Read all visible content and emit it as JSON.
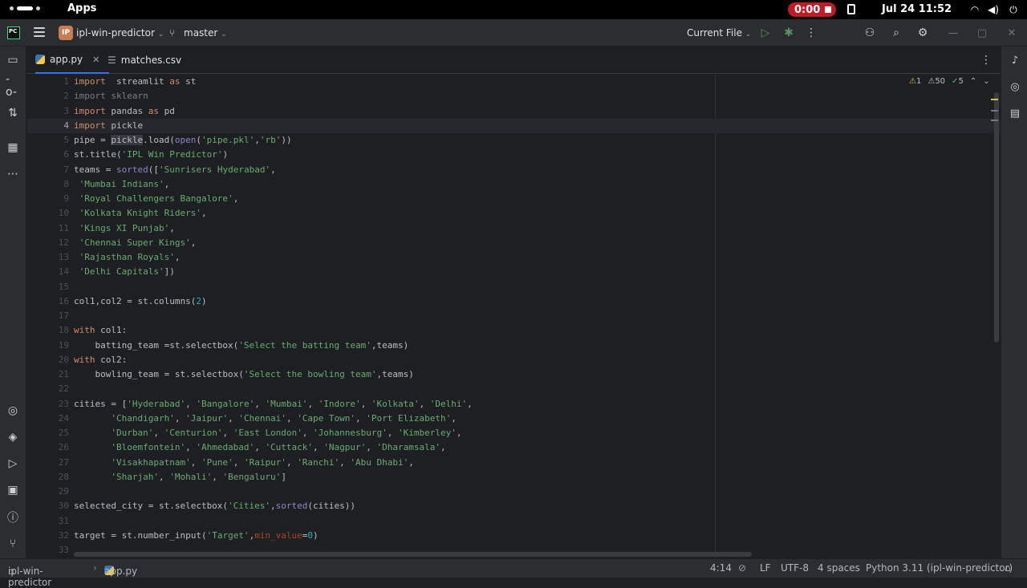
{
  "os": {
    "apps_label": "Apps",
    "recording_time": "0:00",
    "clock": "Jul 24  11:52"
  },
  "toolbar": {
    "app_logo": "PC",
    "project_badge": "IP",
    "project_name": "ipl-win-predictor",
    "branch_name": "master",
    "run_config": "Current File"
  },
  "tabs": [
    {
      "label": "app.py",
      "active": true
    },
    {
      "label": "matches.csv",
      "active": false
    }
  ],
  "inspections": {
    "warnings": "1",
    "weak_warnings": "50",
    "typos": "5"
  },
  "editor": {
    "current_line": 4,
    "lines": [
      {
        "n": "1",
        "t": [
          [
            "kw",
            "import"
          ],
          [
            "",
            "  streamlit "
          ],
          [
            "kw",
            "as"
          ],
          [
            "",
            " st"
          ]
        ]
      },
      {
        "n": "2",
        "t": [
          [
            "dim",
            "import sklearn"
          ]
        ]
      },
      {
        "n": "3",
        "t": [
          [
            "kw",
            "import"
          ],
          [
            "",
            " pandas "
          ],
          [
            "kw",
            "as"
          ],
          [
            "",
            " pd"
          ]
        ]
      },
      {
        "n": "4",
        "t": [
          [
            "kw",
            "import"
          ],
          [
            "",
            " pickle"
          ]
        ]
      },
      {
        "n": "5",
        "t": [
          [
            "",
            "pipe = "
          ],
          [
            "hl",
            "pickle"
          ],
          [
            "",
            ".load("
          ],
          [
            "bi",
            "open"
          ],
          [
            "",
            "("
          ],
          [
            "str",
            "'pipe.pkl'"
          ],
          [
            "",
            ","
          ],
          [
            "str",
            "'rb'"
          ],
          [
            "",
            "))"
          ]
        ]
      },
      {
        "n": "6",
        "t": [
          [
            "",
            "st.title("
          ],
          [
            "str",
            "'IPL Win Predictor'"
          ],
          [
            "",
            ")"
          ]
        ]
      },
      {
        "n": "7",
        "t": [
          [
            "",
            "teams = "
          ],
          [
            "bi",
            "sorted"
          ],
          [
            "",
            "(["
          ],
          [
            "str",
            "'Sunrisers Hyderabad'"
          ],
          [
            "",
            ","
          ]
        ]
      },
      {
        "n": "8",
        "t": [
          [
            "",
            " "
          ],
          [
            "str",
            "'Mumbai Indians'"
          ],
          [
            "",
            ","
          ]
        ]
      },
      {
        "n": "9",
        "t": [
          [
            "",
            " "
          ],
          [
            "str",
            "'Royal Challengers Bangalore'"
          ],
          [
            "",
            ","
          ]
        ]
      },
      {
        "n": "10",
        "t": [
          [
            "",
            " "
          ],
          [
            "str",
            "'Kolkata Knight Riders'"
          ],
          [
            "",
            ","
          ]
        ]
      },
      {
        "n": "11",
        "t": [
          [
            "",
            " "
          ],
          [
            "str",
            "'Kings XI Punjab'"
          ],
          [
            "",
            ","
          ]
        ]
      },
      {
        "n": "12",
        "t": [
          [
            "",
            " "
          ],
          [
            "str",
            "'Chennai Super Kings'"
          ],
          [
            "",
            ","
          ]
        ]
      },
      {
        "n": "13",
        "t": [
          [
            "",
            " "
          ],
          [
            "str",
            "'Rajasthan Royals'"
          ],
          [
            "",
            ","
          ]
        ]
      },
      {
        "n": "14",
        "t": [
          [
            "",
            " "
          ],
          [
            "str",
            "'Delhi Capitals'"
          ],
          [
            "",
            "])"
          ]
        ]
      },
      {
        "n": "15",
        "t": []
      },
      {
        "n": "16",
        "t": [
          [
            "",
            "col1,col2 = st.columns("
          ],
          [
            "num",
            "2"
          ],
          [
            "",
            ")"
          ]
        ]
      },
      {
        "n": "17",
        "t": []
      },
      {
        "n": "18",
        "t": [
          [
            "kw",
            "with"
          ],
          [
            "",
            " col1:"
          ]
        ]
      },
      {
        "n": "19",
        "t": [
          [
            "",
            "    batting_team =st.selectbox("
          ],
          [
            "str",
            "'Select the batting team'"
          ],
          [
            "",
            ",teams)"
          ]
        ]
      },
      {
        "n": "20",
        "t": [
          [
            "kw",
            "with"
          ],
          [
            "",
            " col2:"
          ]
        ]
      },
      {
        "n": "21",
        "t": [
          [
            "",
            "    bowling_team = st.selectbox("
          ],
          [
            "str",
            "'Select the bowling team'"
          ],
          [
            "",
            ",teams)"
          ]
        ]
      },
      {
        "n": "22",
        "t": []
      },
      {
        "n": "23",
        "t": [
          [
            "",
            "cities = ["
          ],
          [
            "str",
            "'Hyderabad'"
          ],
          [
            "",
            ", "
          ],
          [
            "str",
            "'Bangalore'"
          ],
          [
            "",
            ", "
          ],
          [
            "str",
            "'Mumbai'"
          ],
          [
            "",
            ", "
          ],
          [
            "str",
            "'Indore'"
          ],
          [
            "",
            ", "
          ],
          [
            "str",
            "'Kolkata'"
          ],
          [
            "",
            ", "
          ],
          [
            "str",
            "'Delhi'"
          ],
          [
            "",
            ","
          ]
        ]
      },
      {
        "n": "24",
        "t": [
          [
            "",
            "       "
          ],
          [
            "str",
            "'Chandigarh'"
          ],
          [
            "",
            ", "
          ],
          [
            "str",
            "'Jaipur'"
          ],
          [
            "",
            ", "
          ],
          [
            "str",
            "'Chennai'"
          ],
          [
            "",
            ", "
          ],
          [
            "str",
            "'Cape Town'"
          ],
          [
            "",
            ", "
          ],
          [
            "str",
            "'Port Elizabeth'"
          ],
          [
            "",
            ","
          ]
        ]
      },
      {
        "n": "25",
        "t": [
          [
            "",
            "       "
          ],
          [
            "str",
            "'Durban'"
          ],
          [
            "",
            ", "
          ],
          [
            "str",
            "'Centurion'"
          ],
          [
            "",
            ", "
          ],
          [
            "str",
            "'East London'"
          ],
          [
            "",
            ", "
          ],
          [
            "str",
            "'Johannesburg'"
          ],
          [
            "",
            ", "
          ],
          [
            "str",
            "'Kimberley'"
          ],
          [
            "",
            ","
          ]
        ]
      },
      {
        "n": "26",
        "t": [
          [
            "",
            "       "
          ],
          [
            "str",
            "'Bloemfontein'"
          ],
          [
            "",
            ", "
          ],
          [
            "str",
            "'Ahmedabad'"
          ],
          [
            "",
            ", "
          ],
          [
            "str",
            "'Cuttack'"
          ],
          [
            "",
            ", "
          ],
          [
            "str",
            "'Nagpur'"
          ],
          [
            "",
            ", "
          ],
          [
            "str",
            "'Dharamsala'"
          ],
          [
            "",
            ","
          ]
        ]
      },
      {
        "n": "27",
        "t": [
          [
            "",
            "       "
          ],
          [
            "str",
            "'Visakhapatnam'"
          ],
          [
            "",
            ", "
          ],
          [
            "str",
            "'Pune'"
          ],
          [
            "",
            ", "
          ],
          [
            "str",
            "'Raipur'"
          ],
          [
            "",
            ", "
          ],
          [
            "str",
            "'Ranchi'"
          ],
          [
            "",
            ", "
          ],
          [
            "str",
            "'Abu Dhabi'"
          ],
          [
            "",
            ","
          ]
        ]
      },
      {
        "n": "28",
        "t": [
          [
            "",
            "       "
          ],
          [
            "str",
            "'Sharjah'"
          ],
          [
            "",
            ", "
          ],
          [
            "str",
            "'Mohali'"
          ],
          [
            "",
            ", "
          ],
          [
            "str",
            "'Bengaluru'"
          ],
          [
            "",
            "]"
          ]
        ]
      },
      {
        "n": "29",
        "t": []
      },
      {
        "n": "30",
        "t": [
          [
            "",
            "selected_city = st.selectbox("
          ],
          [
            "str",
            "'Cities'"
          ],
          [
            "",
            ","
          ],
          [
            "bi",
            "sorted"
          ],
          [
            "",
            "(cities))"
          ]
        ]
      },
      {
        "n": "31",
        "t": []
      },
      {
        "n": "32",
        "t": [
          [
            "",
            "target = st.number_input("
          ],
          [
            "str",
            "'Target'"
          ],
          [
            "",
            ","
          ],
          [
            "param",
            "min_value"
          ],
          [
            "",
            "="
          ],
          [
            "num",
            "0"
          ],
          [
            "",
            ")"
          ]
        ]
      },
      {
        "n": "33",
        "t": []
      }
    ]
  },
  "status": {
    "project": "ipl-win-predictor",
    "file": "app.py",
    "position": "4:14",
    "line_sep": "LF",
    "encoding": "UTF-8",
    "indent": "4 spaces",
    "interpreter": "Python 3.11 (ipl-win-predictor)"
  },
  "icons": {
    "left_strip": [
      "folder-icon",
      "commit-icon",
      "pull-requests-icon",
      "structure-icon",
      "more-icon",
      "python-console-icon",
      "layers-icon",
      "services-icon",
      "terminal-icon",
      "problems-icon",
      "git-icon"
    ],
    "right_strip": [
      "notifications-icon",
      "ai-assistant-icon",
      "database-icon"
    ]
  },
  "colors": {
    "accent": "#3574f0",
    "record": "#c01c28",
    "keyword": "#cf8e6d",
    "string": "#6aab73",
    "number": "#2aacb8"
  }
}
